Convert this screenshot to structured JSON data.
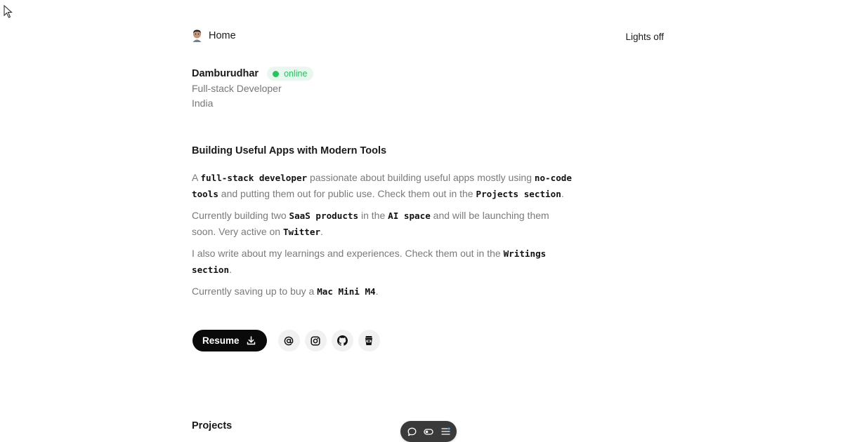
{
  "nav": {
    "home_label": "Home",
    "theme_toggle_label": "Lights off"
  },
  "profile": {
    "name": "Damburudhar",
    "status": "online",
    "status_color": "#22c55e",
    "role": "Full-stack Developer",
    "location": "India"
  },
  "about": {
    "title": "Building Useful Apps with Modern Tools",
    "p1": {
      "t1": "A ",
      "c1": "full-stack developer",
      "t2": " passionate about building useful apps mostly using ",
      "c2": "no-code tools",
      "t3": " and putting them out for public use. Check them out in the ",
      "c3": "Projects section",
      "t4": "."
    },
    "p2": {
      "t1": "Currently building two ",
      "c1": "SaaS products",
      "t2": " in the ",
      "c2": "AI space",
      "t3": " and will be launching them soon. Very active on ",
      "c3": "Twitter",
      "t4": "."
    },
    "p3": {
      "t1": "I also write about my learnings and experiences. Check them out in the ",
      "c1": "Writings section",
      "t2": "."
    },
    "p4": {
      "t1": "Currently saving up to buy a ",
      "c1": "Mac Mini M4",
      "t2": "."
    }
  },
  "actions": {
    "resume_label": "Resume",
    "resume_icon": "download-icon",
    "social_icons": [
      "at-sign-icon",
      "instagram-icon",
      "github-icon",
      "coffee-cup-icon"
    ]
  },
  "projects": {
    "title": "Projects"
  },
  "dock": {
    "icons": [
      "chat-bubble-icon",
      "toggle-icon",
      "menu-icon"
    ]
  }
}
